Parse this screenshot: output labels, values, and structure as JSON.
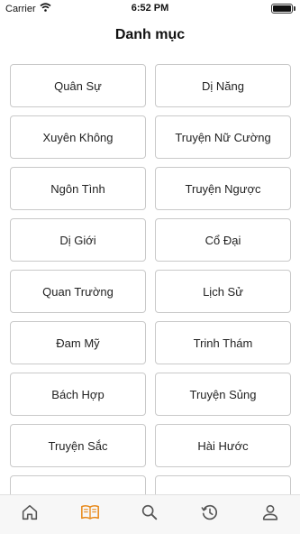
{
  "status_bar": {
    "carrier": "Carrier",
    "time": "6:52 PM"
  },
  "page_title": "Danh mục",
  "categories": [
    {
      "label": "Quân Sự"
    },
    {
      "label": "Dị Năng"
    },
    {
      "label": "Xuyên Không"
    },
    {
      "label": "Truyện Nữ Cường"
    },
    {
      "label": "Ngôn Tình"
    },
    {
      "label": "Truyện Ngược"
    },
    {
      "label": "Dị Giới"
    },
    {
      "label": "Cổ Đại"
    },
    {
      "label": "Quan Trường"
    },
    {
      "label": "Lịch Sử"
    },
    {
      "label": "Đam Mỹ"
    },
    {
      "label": "Trinh Thám"
    },
    {
      "label": "Bách Hợp"
    },
    {
      "label": "Truyện Sủng"
    },
    {
      "label": "Truyện Sắc"
    },
    {
      "label": "Hài Hước"
    },
    {
      "label": ""
    },
    {
      "label": ""
    }
  ],
  "tab_bar": {
    "active_color": "#e8891a",
    "inactive_color": "#555555",
    "tabs": [
      {
        "icon": "home-icon",
        "active": false
      },
      {
        "icon": "book-icon",
        "active": true
      },
      {
        "icon": "search-icon",
        "active": false
      },
      {
        "icon": "history-icon",
        "active": false
      },
      {
        "icon": "user-icon",
        "active": false
      }
    ]
  }
}
